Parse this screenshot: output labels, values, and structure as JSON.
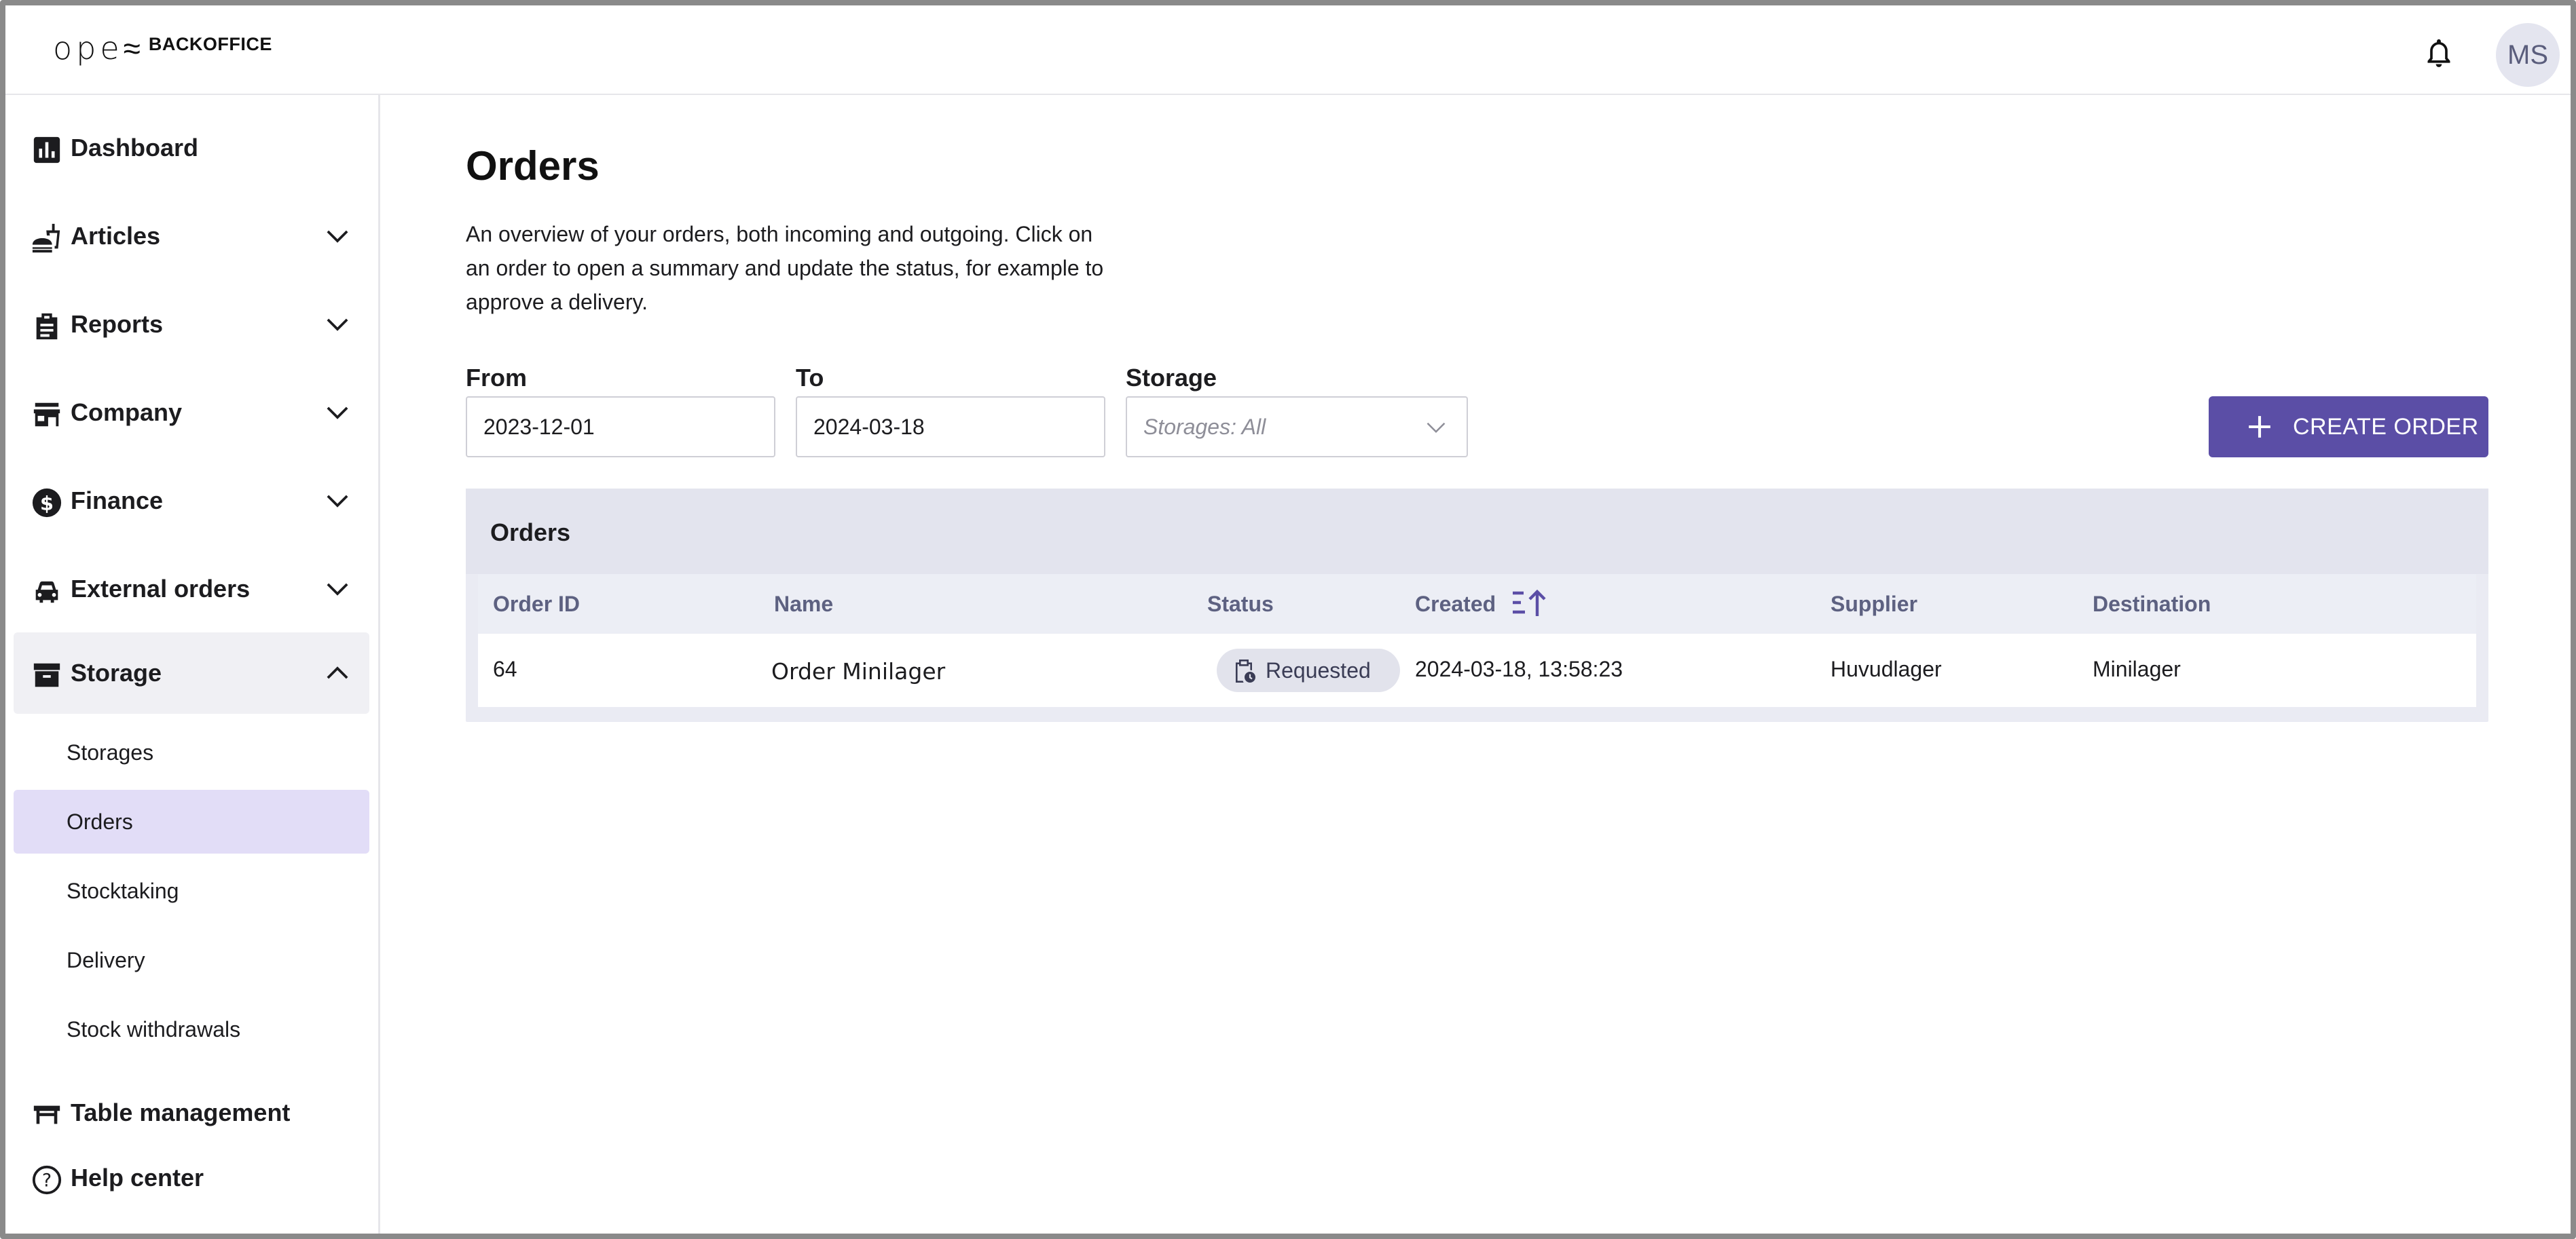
{
  "header": {
    "logo_mark": "ope≈",
    "logo_text": "BACKOFFICE",
    "avatar_initials": "MS"
  },
  "sidebar": {
    "items": [
      {
        "label": "Dashboard",
        "icon": "dashboard-icon"
      },
      {
        "label": "Articles",
        "icon": "articles-icon",
        "expandable": true
      },
      {
        "label": "Reports",
        "icon": "reports-icon",
        "expandable": true
      },
      {
        "label": "Company",
        "icon": "company-icon",
        "expandable": true
      },
      {
        "label": "Finance",
        "icon": "finance-icon",
        "expandable": true
      },
      {
        "label": "External orders",
        "icon": "car-icon",
        "expandable": true
      },
      {
        "label": "Storage",
        "icon": "storage-icon",
        "expandable": true,
        "expanded": true
      },
      {
        "label": "Table management",
        "icon": "table-icon"
      },
      {
        "label": "Help center",
        "icon": "help-icon"
      }
    ],
    "storage_sub": [
      {
        "label": "Storages"
      },
      {
        "label": "Orders",
        "active": true
      },
      {
        "label": "Stocktaking"
      },
      {
        "label": "Delivery"
      },
      {
        "label": "Stock withdrawals"
      }
    ]
  },
  "main": {
    "title": "Orders",
    "description": "An overview of your orders, both incoming and outgoing. Click on an order to open a summary and update the status, for example to approve a delivery.",
    "filters": {
      "from_label": "From",
      "from_value": "2023-12-01",
      "to_label": "To",
      "to_value": "2024-03-18",
      "storage_label": "Storage",
      "storage_placeholder": "Storages: All"
    },
    "create_button": "CREATE ORDER",
    "table": {
      "title": "Orders",
      "columns": [
        "Order ID",
        "Name",
        "Status",
        "Created",
        "Supplier",
        "Destination"
      ],
      "rows": [
        {
          "order_id": "64",
          "name": "Order Minilager",
          "status": "Requested",
          "created": "2024-03-18, 13:58:23",
          "supplier": "Huvudlager",
          "destination": "Minilager"
        }
      ]
    }
  },
  "colors": {
    "accent": "#5b4ea6",
    "active_nav": "#e2ddf7",
    "table_header_text": "#5d6181"
  }
}
